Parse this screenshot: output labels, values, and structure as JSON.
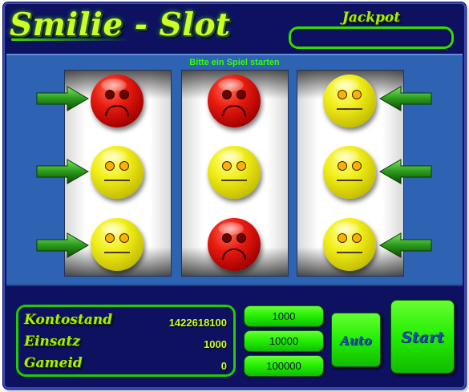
{
  "header": {
    "title": "Smilie - Slot",
    "jackpot_label": "Jackpot",
    "jackpot_value": ""
  },
  "status": "Bitte ein Spiel starten",
  "reels": [
    [
      "sad-red",
      "neutral-yellow",
      "neutral-yellow"
    ],
    [
      "sad-red",
      "neutral-yellow",
      "sad-red"
    ],
    [
      "neutral-yellow",
      "neutral-yellow",
      "neutral-yellow"
    ]
  ],
  "info": {
    "kontostand_label": "Kontostand",
    "kontostand_value": "1422618100",
    "einsatz_label": "Einsatz",
    "einsatz_value": "1000",
    "gameid_label": "Gameid",
    "gameid_value": "0"
  },
  "bet_buttons": [
    "1000",
    "10000",
    "100000"
  ],
  "auto_label": "Auto",
  "start_label": "Start",
  "colors": {
    "frame": "#0d1160",
    "game_area": "#2d63b2",
    "accent_green": "#22ee00",
    "text_green": "#aaee00"
  }
}
